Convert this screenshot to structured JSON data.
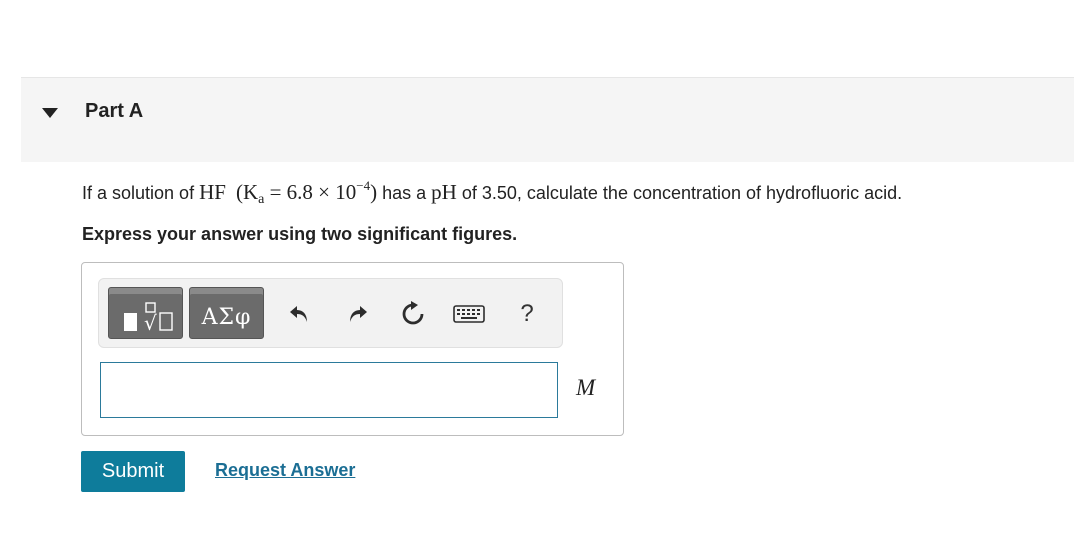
{
  "part": {
    "title": "Part A"
  },
  "question": {
    "prefix": "If a solution of ",
    "compound": "HF",
    "ka_open": "(K",
    "ka_sub": "a",
    "ka_eq": " = 6.8 × 10",
    "ka_exp": "−4",
    "ka_close": ")",
    "mid": " has a ",
    "ph_symbol": "pH",
    "suffix": " of 3.50, calculate the concentration of hydrofluoric acid."
  },
  "instruction": "Express your answer using two significant figures.",
  "toolbar": {
    "greek_label": "ΑΣφ",
    "help_label": "?"
  },
  "answer": {
    "value": "",
    "unit": "M"
  },
  "actions": {
    "submit_label": "Submit",
    "request_label": "Request Answer"
  },
  "colors": {
    "accent": "#0e7c9b",
    "link": "#1b6e94",
    "input_border": "#2b7a9b"
  }
}
